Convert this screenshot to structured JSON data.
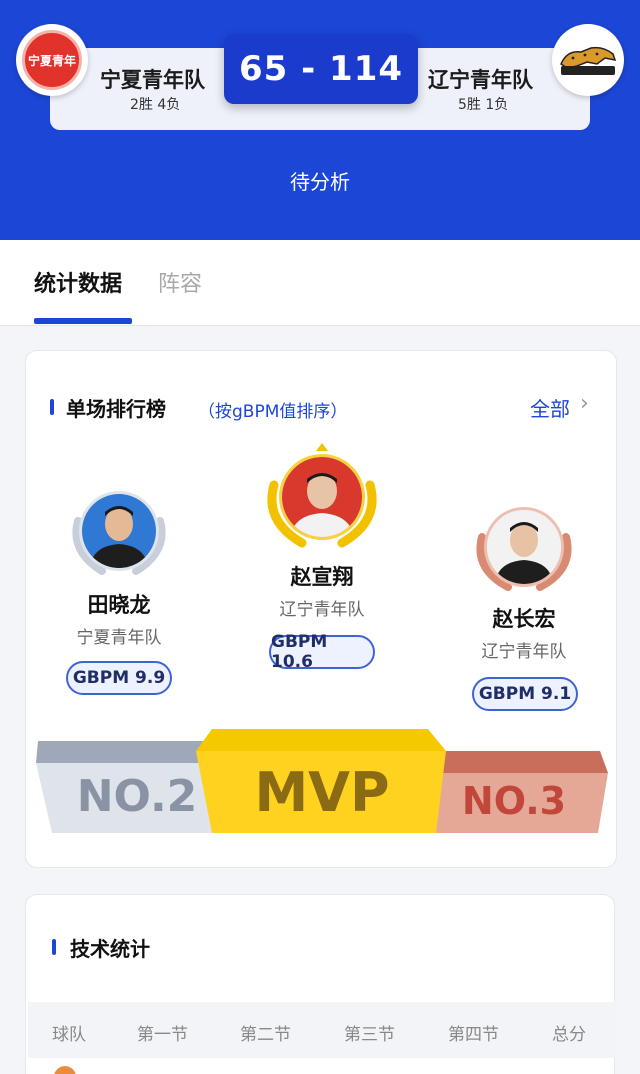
{
  "match": {
    "home_team": "宁夏青年队",
    "home_record": "2胜 4负",
    "home_logo_text": "宁夏青年",
    "away_team": "辽宁青年队",
    "away_record": "5胜 1负",
    "score": "65 - 114",
    "status": "待分析"
  },
  "tabs": [
    "统计数据",
    "阵容"
  ],
  "ranking": {
    "title": "单场排行榜",
    "subtitle": "（按gBPM值排序）",
    "all_link": "全部",
    "players": [
      {
        "rank_label": "NO.2",
        "name": "田晓龙",
        "team": "宁夏青年队",
        "gbpm": "GBPM 9.9",
        "medal": "silver"
      },
      {
        "rank_label": "MVP",
        "name": "赵宣翔",
        "team": "辽宁青年队",
        "gbpm": "GBPM 10.6",
        "medal": "gold"
      },
      {
        "rank_label": "NO.3",
        "name": "赵长宏",
        "team": "辽宁青年队",
        "gbpm": "GBPM 9.1",
        "medal": "bronze"
      }
    ]
  },
  "tech_stats": {
    "title": "技术统计",
    "columns": [
      "球队",
      "第一节",
      "第二节",
      "第三节",
      "第四节",
      "总分"
    ]
  },
  "colors": {
    "primary": "#1c46d6",
    "gold": "#f6c800",
    "silver": "#c8cfda",
    "bronze": "#d98a72"
  },
  "icons": {
    "more": "chevron-right-icon",
    "medal": "laurel-wreath-icon"
  }
}
